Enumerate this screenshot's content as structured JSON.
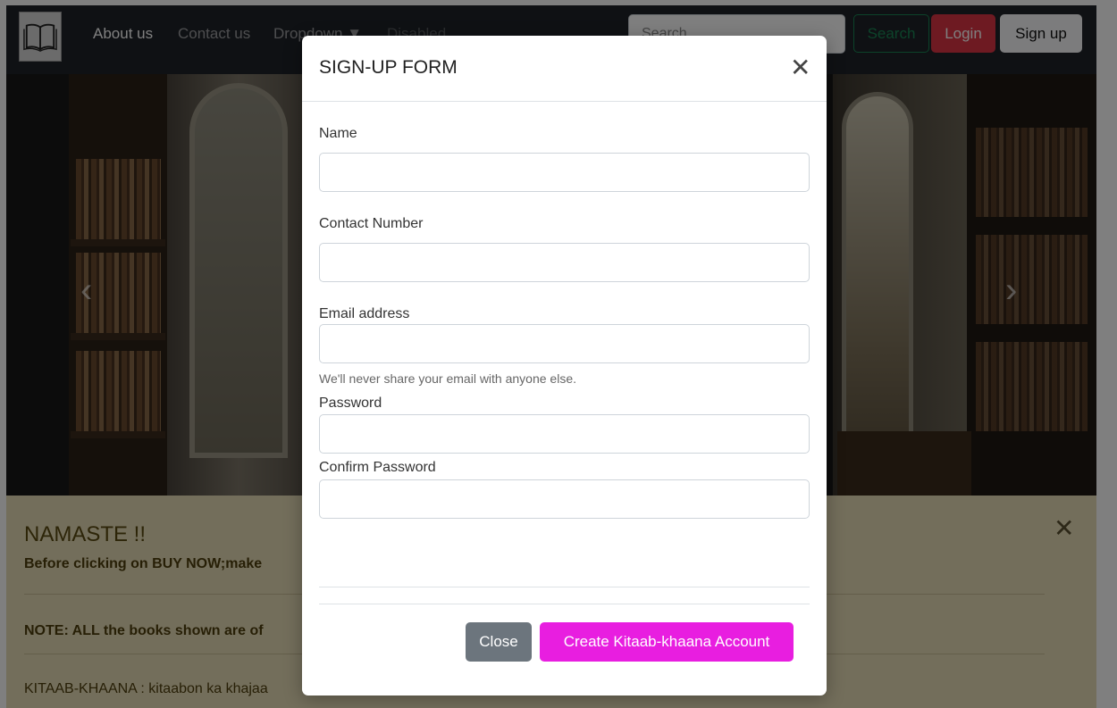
{
  "navbar": {
    "links": [
      {
        "label": "About us"
      },
      {
        "label": "Contact us"
      },
      {
        "label": "Dropdown ▼"
      },
      {
        "label": "Disabled"
      }
    ],
    "search_placeholder": "Search",
    "search_button": "Search",
    "login_button": "Login",
    "signup_button": "Sign up"
  },
  "alert": {
    "heading": "NAMASTE !!",
    "line1": "Before clicking on BUY NOW;make",
    "note_label": "NOTE:",
    "note_text": " ALL the books shown are of",
    "footer_text": "KITAAB-KHAANA : kitaabon ka khajaa"
  },
  "modal": {
    "title": "SIGN-UP FORM",
    "fields": {
      "name_label": "Name",
      "contact_label": "Contact Number",
      "email_label": "Email address",
      "email_help": "We'll never share your email with anyone else.",
      "password_label": "Password",
      "confirm_label": "Confirm Password"
    },
    "close_button": "Close",
    "create_button": "Create Kitaab-khaana Account"
  },
  "colors": {
    "navbar_bg": "#1f2328",
    "login": "#dc3545",
    "create": "#e81ee0",
    "alert_bg": "#e7dcb7"
  }
}
